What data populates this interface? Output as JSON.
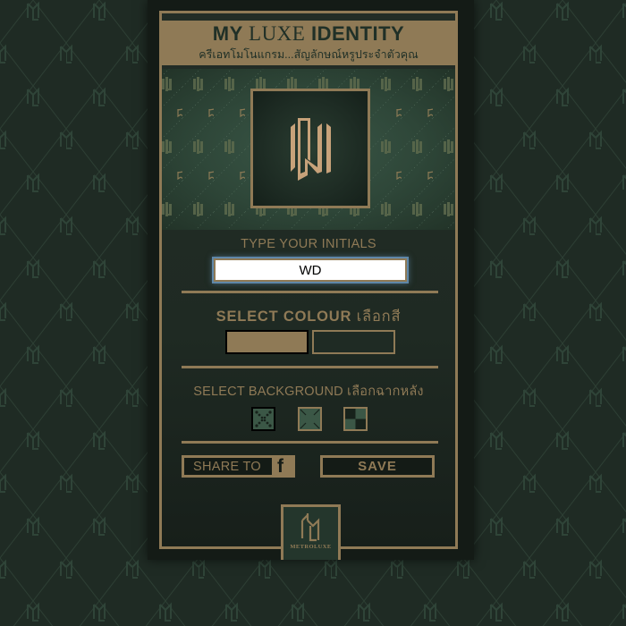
{
  "header": {
    "title_part1": "MY ",
    "title_part2": "LUXE",
    "title_part3": " IDENTITY",
    "subtitle": "ครีเอทโมโนแกรม...สัญลักษณ์หรูประจำตัวคุณ"
  },
  "preview": {
    "monogram_icon": "iu-monogram-icon",
    "pattern_icon": "monogram-pattern-icon"
  },
  "initials": {
    "label": "TYPE YOUR INITIALS",
    "value": "WD",
    "placeholder": ""
  },
  "colour": {
    "label": "SELECT COLOUR",
    "label_th": "เลือกสี",
    "options": [
      {
        "name": "gold",
        "hex": "#8f7a56",
        "selected": true
      },
      {
        "name": "dark-green",
        "hex": "#1f2b24",
        "selected": false
      }
    ]
  },
  "background": {
    "label": "SELECT BACKGROUND",
    "label_th": "เลือกฉากหลัง",
    "options": [
      {
        "name": "dot-pattern",
        "selected": true
      },
      {
        "name": "corner-lines",
        "selected": false
      },
      {
        "name": "checker",
        "selected": false
      }
    ]
  },
  "actions": {
    "share_label": "SHARE TO",
    "share_icon": "facebook-icon",
    "share_glyph": "f",
    "save_label": "SAVE"
  },
  "footer": {
    "brand": "METROLUXE",
    "logo_icon": "metroluxe-logo-icon"
  },
  "colors": {
    "gold": "#8f7a56",
    "dark_green": "#1f2b24",
    "card_bg": "#141b16"
  }
}
